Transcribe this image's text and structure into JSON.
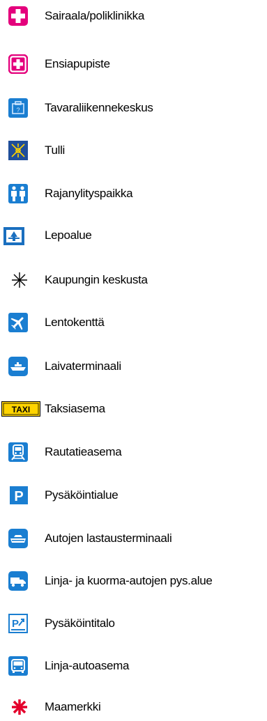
{
  "legend": {
    "items": [
      {
        "label": "Sairaala/poliklinikka",
        "icon": "hospital-icon"
      },
      {
        "label": "Ensiapupiste",
        "icon": "first-aid-icon"
      },
      {
        "label": "Tavaraliikennekeskus",
        "icon": "freight-center-icon"
      },
      {
        "label": "Tulli",
        "icon": "customs-icon"
      },
      {
        "label": "Rajanylityspaikka",
        "icon": "border-crossing-icon"
      },
      {
        "label": "Lepoalue",
        "icon": "rest-area-icon"
      },
      {
        "label": "Kaupungin keskusta",
        "icon": "city-center-icon"
      },
      {
        "label": "Lentokenttä",
        "icon": "airport-icon"
      },
      {
        "label": "Laivaterminaali",
        "icon": "ship-terminal-icon"
      },
      {
        "label": "Taksiasema",
        "icon": "taxi-icon",
        "icon_text": "TAXI"
      },
      {
        "label": "Rautatieasema",
        "icon": "railway-station-icon"
      },
      {
        "label": "Pysäköintialue",
        "icon": "parking-area-icon",
        "icon_text": "P"
      },
      {
        "label": "Autojen lastausterminaali",
        "icon": "car-loading-terminal-icon"
      },
      {
        "label": "Linja- ja kuorma-autojen pys.alue",
        "icon": "bus-truck-parking-icon"
      },
      {
        "label": "Pysäköintitalo",
        "icon": "parking-garage-icon",
        "icon_text": "P"
      },
      {
        "label": "Linja-autoasema",
        "icon": "bus-station-icon"
      },
      {
        "label": "Maamerkki",
        "icon": "landmark-icon"
      }
    ]
  },
  "colors": {
    "magenta": "#e4007c",
    "blue": "#1a7ed1",
    "dark_blue": "#1f4e9a",
    "taxi_yellow": "#ffd400",
    "red": "#e4002b"
  }
}
